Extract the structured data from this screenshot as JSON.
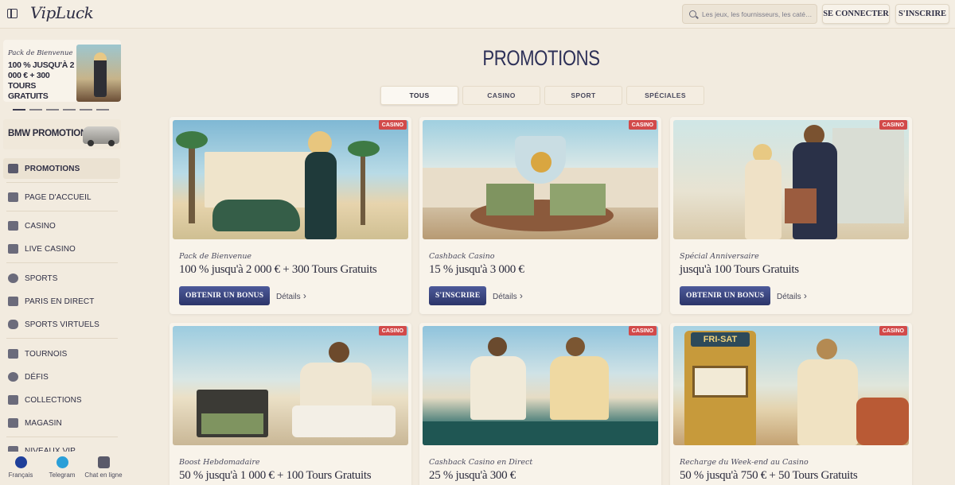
{
  "header": {
    "logo": "VipLuck",
    "search_placeholder": "Les jeux, les fournisseurs, les caté…",
    "login_label": "SE CONNECTER",
    "register_label": "S'INSCRIRE"
  },
  "sidebar": {
    "promo_card": {
      "title": "Pack de Bienvenue",
      "text": "100 % JUSQU'À 2 000 € + 300 TOURS GRATUITS"
    },
    "bmw_label": "BMW PROMOTION",
    "items": [
      {
        "label": "PROMOTIONS",
        "icon": "gift-icon"
      },
      {
        "label": "PAGE D'ACCUEIL",
        "icon": "home-icon"
      },
      {
        "label": "CASINO",
        "icon": "slot-machine-icon"
      },
      {
        "label": "LIVE CASINO",
        "icon": "cards-icon"
      },
      {
        "label": "SPORTS",
        "icon": "soccer-ball-icon"
      },
      {
        "label": "PARIS EN DIRECT",
        "icon": "tv-icon"
      },
      {
        "label": "SPORTS VIRTUELS",
        "icon": "gamepad-icon"
      },
      {
        "label": "TOURNOIS",
        "icon": "trophy-icon"
      },
      {
        "label": "DÉFIS",
        "icon": "medal-icon"
      },
      {
        "label": "COLLECTIONS",
        "icon": "book-icon"
      },
      {
        "label": "MAGASIN",
        "icon": "shop-bag-icon"
      },
      {
        "label": "NIVEAUX VIP",
        "icon": "crown-icon"
      }
    ],
    "footer": [
      {
        "label": "Français",
        "icon": "eu-flag-icon"
      },
      {
        "label": "Telegram",
        "icon": "telegram-icon"
      },
      {
        "label": "Chat en ligne",
        "icon": "chat-icon"
      }
    ]
  },
  "main": {
    "title": "PROMOTIONS",
    "tabs": [
      "TOUS",
      "CASINO",
      "SPORT",
      "SPÉCIALES"
    ],
    "cards": [
      {
        "badge": "CASINO",
        "subtitle": "Pack de Bienvenue",
        "title": "100 % jusqu'à 2 000 € + 300 Tours Gratuits",
        "cta": "OBTENIR UN BONUS",
        "details": "Détails"
      },
      {
        "badge": "CASINO",
        "subtitle": "Cashback Casino",
        "title": "15 % jusqu'à 3 000 €",
        "cta": "S'INSCRIRE",
        "details": "Détails"
      },
      {
        "badge": "CASINO",
        "subtitle": "Spécial Anniversaire",
        "title": "jusqu'à 100 Tours Gratuits",
        "cta": "OBTENIR UN BONUS",
        "details": "Détails"
      },
      {
        "badge": "CASINO",
        "subtitle": "Boost Hebdomadaire",
        "title": "50 % jusqu'à 1 000 € + 100 Tours Gratuits"
      },
      {
        "badge": "CASINO",
        "subtitle": "Cashback Casino en Direct",
        "title": "25 % jusqu'à 300 €"
      },
      {
        "badge": "CASINO",
        "subtitle": "Recharge du Week-end au Casino",
        "title": "50 % jusqu'à 750 € + 50 Tours Gratuits",
        "slot_text": "FRI-SAT"
      }
    ],
    "colors": {
      "accent": "#2e3158",
      "badge": "#d24a4a",
      "background": "#f2ebdf"
    }
  }
}
